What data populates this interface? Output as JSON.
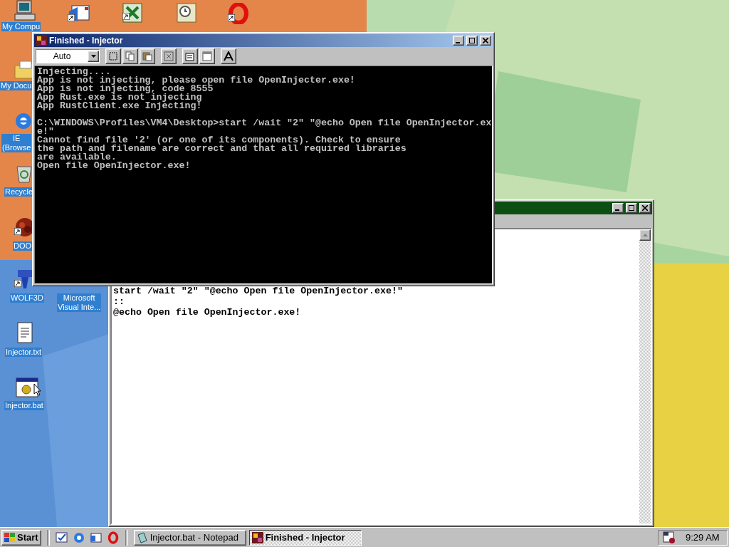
{
  "desktop_icons": [
    {
      "kind": "computer"
    },
    {
      "kind": "mail"
    },
    {
      "kind": "spreadsheet"
    },
    {
      "kind": "scheduler"
    },
    {
      "kind": "opera"
    },
    {
      "kind": "folder"
    },
    {
      "kind": "browser"
    },
    {
      "kind": "recycle"
    },
    {
      "kind": "game"
    },
    {
      "kind": "game3d"
    },
    {
      "kind": "hidden"
    },
    {
      "kind": "textfile"
    },
    {
      "kind": "batch"
    }
  ],
  "desktop_labels": [
    {
      "lines": [
        "My Compu"
      ]
    },
    {
      "lines": [
        "My Docu"
      ]
    },
    {
      "lines": [
        "IE",
        "(Browse"
      ]
    },
    {
      "lines": [
        "Recycle"
      ]
    },
    {
      "lines": [
        "DOO"
      ]
    },
    {
      "lines": [
        "WOLF3D"
      ]
    },
    {
      "lines": [
        "Microsoft",
        "Visual Inte..."
      ]
    },
    {
      "lines": [
        "Injector.txt"
      ]
    },
    {
      "lines": [
        "Injector.bat"
      ]
    }
  ],
  "notepad_window": {
    "lines": [
      "start /wait \"2\" \"@echo Open file OpenInjector.exe!\"",
      "::",
      "@echo Open file OpenInjector.exe!"
    ]
  },
  "console_window": {
    "title": "Finished - Injector",
    "font_size": "Auto",
    "blocks": [
      [
        "Injecting....",
        "App is not injecting, please open file OpenInjecter.exe!",
        "App is not injecting, code 8555",
        "App Rust.exe is not injecting",
        "App RustClient.exe Injecting!"
      ],
      [
        "C:\\WINDOWS\\Profiles\\VM4\\Desktop>start /wait \"2\" \"@echo Open file OpenInjector.ex",
        "e!\"",
        "Cannot find file '2' (or one of its components). Check to ensure",
        "the path and filename are correct and that all required libraries",
        "are available.",
        "Open file OpenInjector.exe!"
      ]
    ]
  },
  "taskbar": {
    "start": "Start",
    "tasks": [
      {
        "label": "Injector.bat - Notepad",
        "kind": "notepad",
        "selected": false
      },
      {
        "label": "Finished - Injector",
        "kind": "console",
        "selected": true
      }
    ],
    "clock": "9:29 AM"
  }
}
